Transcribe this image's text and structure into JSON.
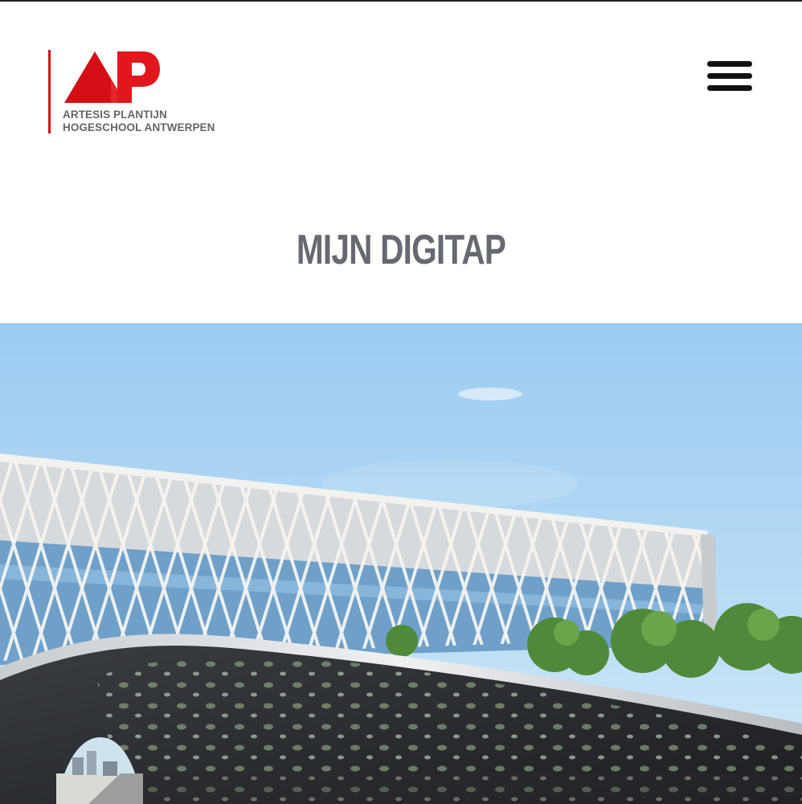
{
  "header": {
    "logo": {
      "mark_text": "AP",
      "line1": "ARTESIS PLANTIJN",
      "line2": "HOGESCHOOL ANTWERPEN",
      "brand_red": "#d50f16",
      "brand_red_light": "#f0383e",
      "text_gray": "#666666"
    },
    "menu_icon": "hamburger-menu-icon"
  },
  "page": {
    "title": "MIJN DIGITAP",
    "title_color": "#666a70"
  },
  "hero": {
    "image_subject": "campus building with diamond facade and perforated bridge",
    "sky_color": "#a9d2f3",
    "facade_color": "#e8e8e4",
    "bridge_color": "#2b2d30"
  }
}
